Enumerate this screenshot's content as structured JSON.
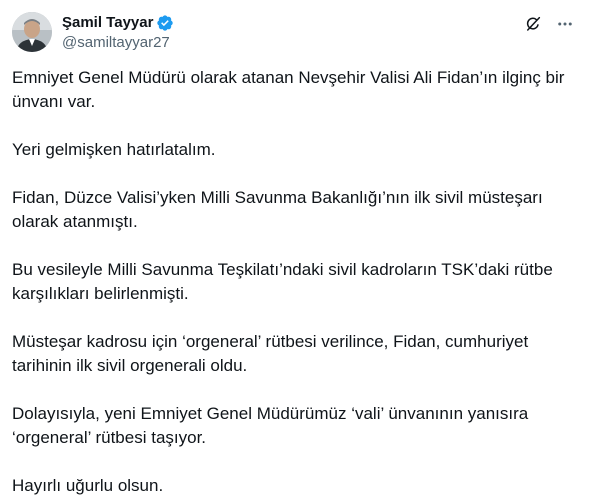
{
  "author": {
    "display_name": "Şamil Tayyar",
    "handle": "@samiltayyar27",
    "avatar_icon": "profile-photo",
    "verified_icon": "verified-badge-icon",
    "verified_color": "#1d9bf0"
  },
  "actions": {
    "grok_icon": "grok-icon",
    "more_icon": "more-dots-icon"
  },
  "tweet": {
    "paragraphs": [
      "Emniyet Genel Müdürü olarak atanan Nevşehir Valisi Ali Fidan’ın ilginç bir ünvanı var.",
      "Yeri gelmişken hatırlatalım.",
      "Fidan, Düzce Valisi’yken Milli Savunma Bakanlığı’nın ilk sivil müsteşarı olarak atanmıştı.",
      "Bu vesileyle Milli Savunma Teşkilatı’ndaki sivil kadroların TSK’daki rütbe karşılıkları belirlenmişti.",
      "Müsteşar kadrosu için ‘orgeneral’ rütbesi verilince, Fidan, cumhuriyet tarihinin ilk sivil orgenerali oldu.",
      "Dolayısıyla, yeni Emniyet Genel Müdürümüz ‘vali’ ünvanının yanısıra ‘orgeneral’ rütbesi taşıyor.",
      "Hayırlı uğurlu olsun."
    ]
  },
  "colors": {
    "text_primary": "#0f1419",
    "text_secondary": "#536471",
    "accent": "#1d9bf0"
  }
}
